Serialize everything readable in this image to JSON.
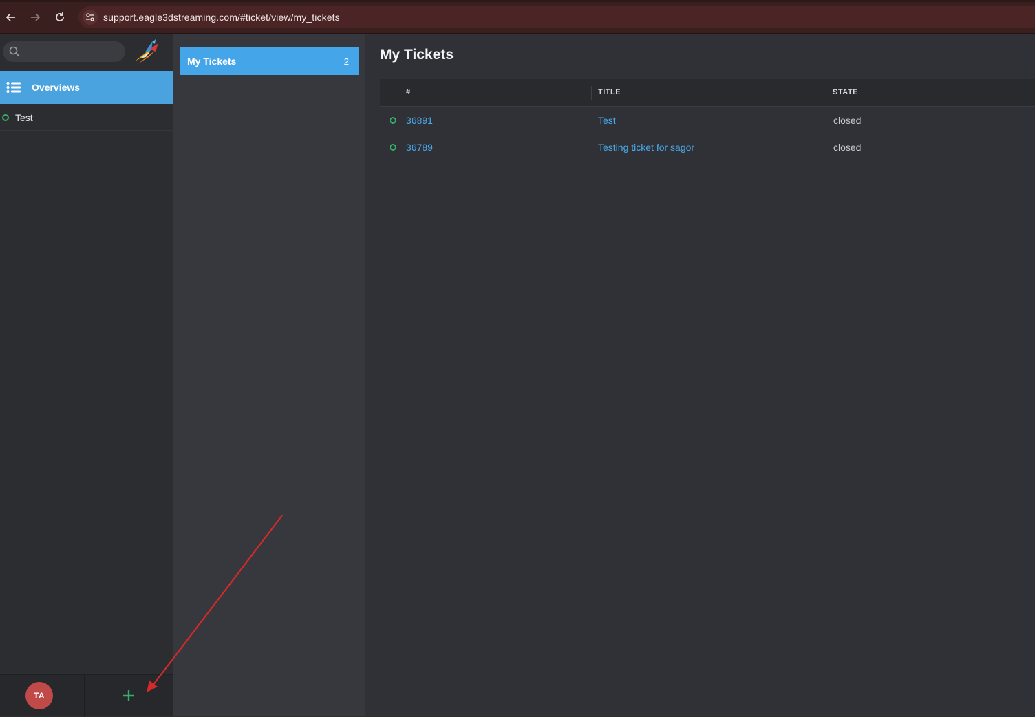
{
  "browser": {
    "url": "support.eagle3dstreaming.com/#ticket/view/my_tickets",
    "back_icon": "arrow-left-icon",
    "forward_icon": "arrow-right-icon",
    "reload_icon": "reload-icon",
    "site_info_icon": "tune-icon"
  },
  "sidebar": {
    "search": {
      "placeholder": "",
      "value": ""
    },
    "nav": [
      {
        "label": "Overviews",
        "icon": "list-icon",
        "active": true
      },
      {
        "label": "Test",
        "icon": "status-ring-icon"
      }
    ],
    "footer": {
      "avatar_initials": "TA",
      "avatar_color": "#c04a48",
      "add_icon": "plus-icon"
    }
  },
  "overviews": [
    {
      "label": "My Tickets",
      "count": "2",
      "active": true
    }
  ],
  "main": {
    "title": "My Tickets",
    "columns": [
      "#",
      "TITLE",
      "STATE"
    ],
    "rows": [
      {
        "number": "36891",
        "title": "Test",
        "state": "closed"
      },
      {
        "number": "36789",
        "title": "Testing ticket for sagor",
        "state": "closed"
      }
    ]
  },
  "colors": {
    "accent": "#4aa3df",
    "status_open": "#38ad69",
    "annotation_arrow": "#d42a2a"
  }
}
